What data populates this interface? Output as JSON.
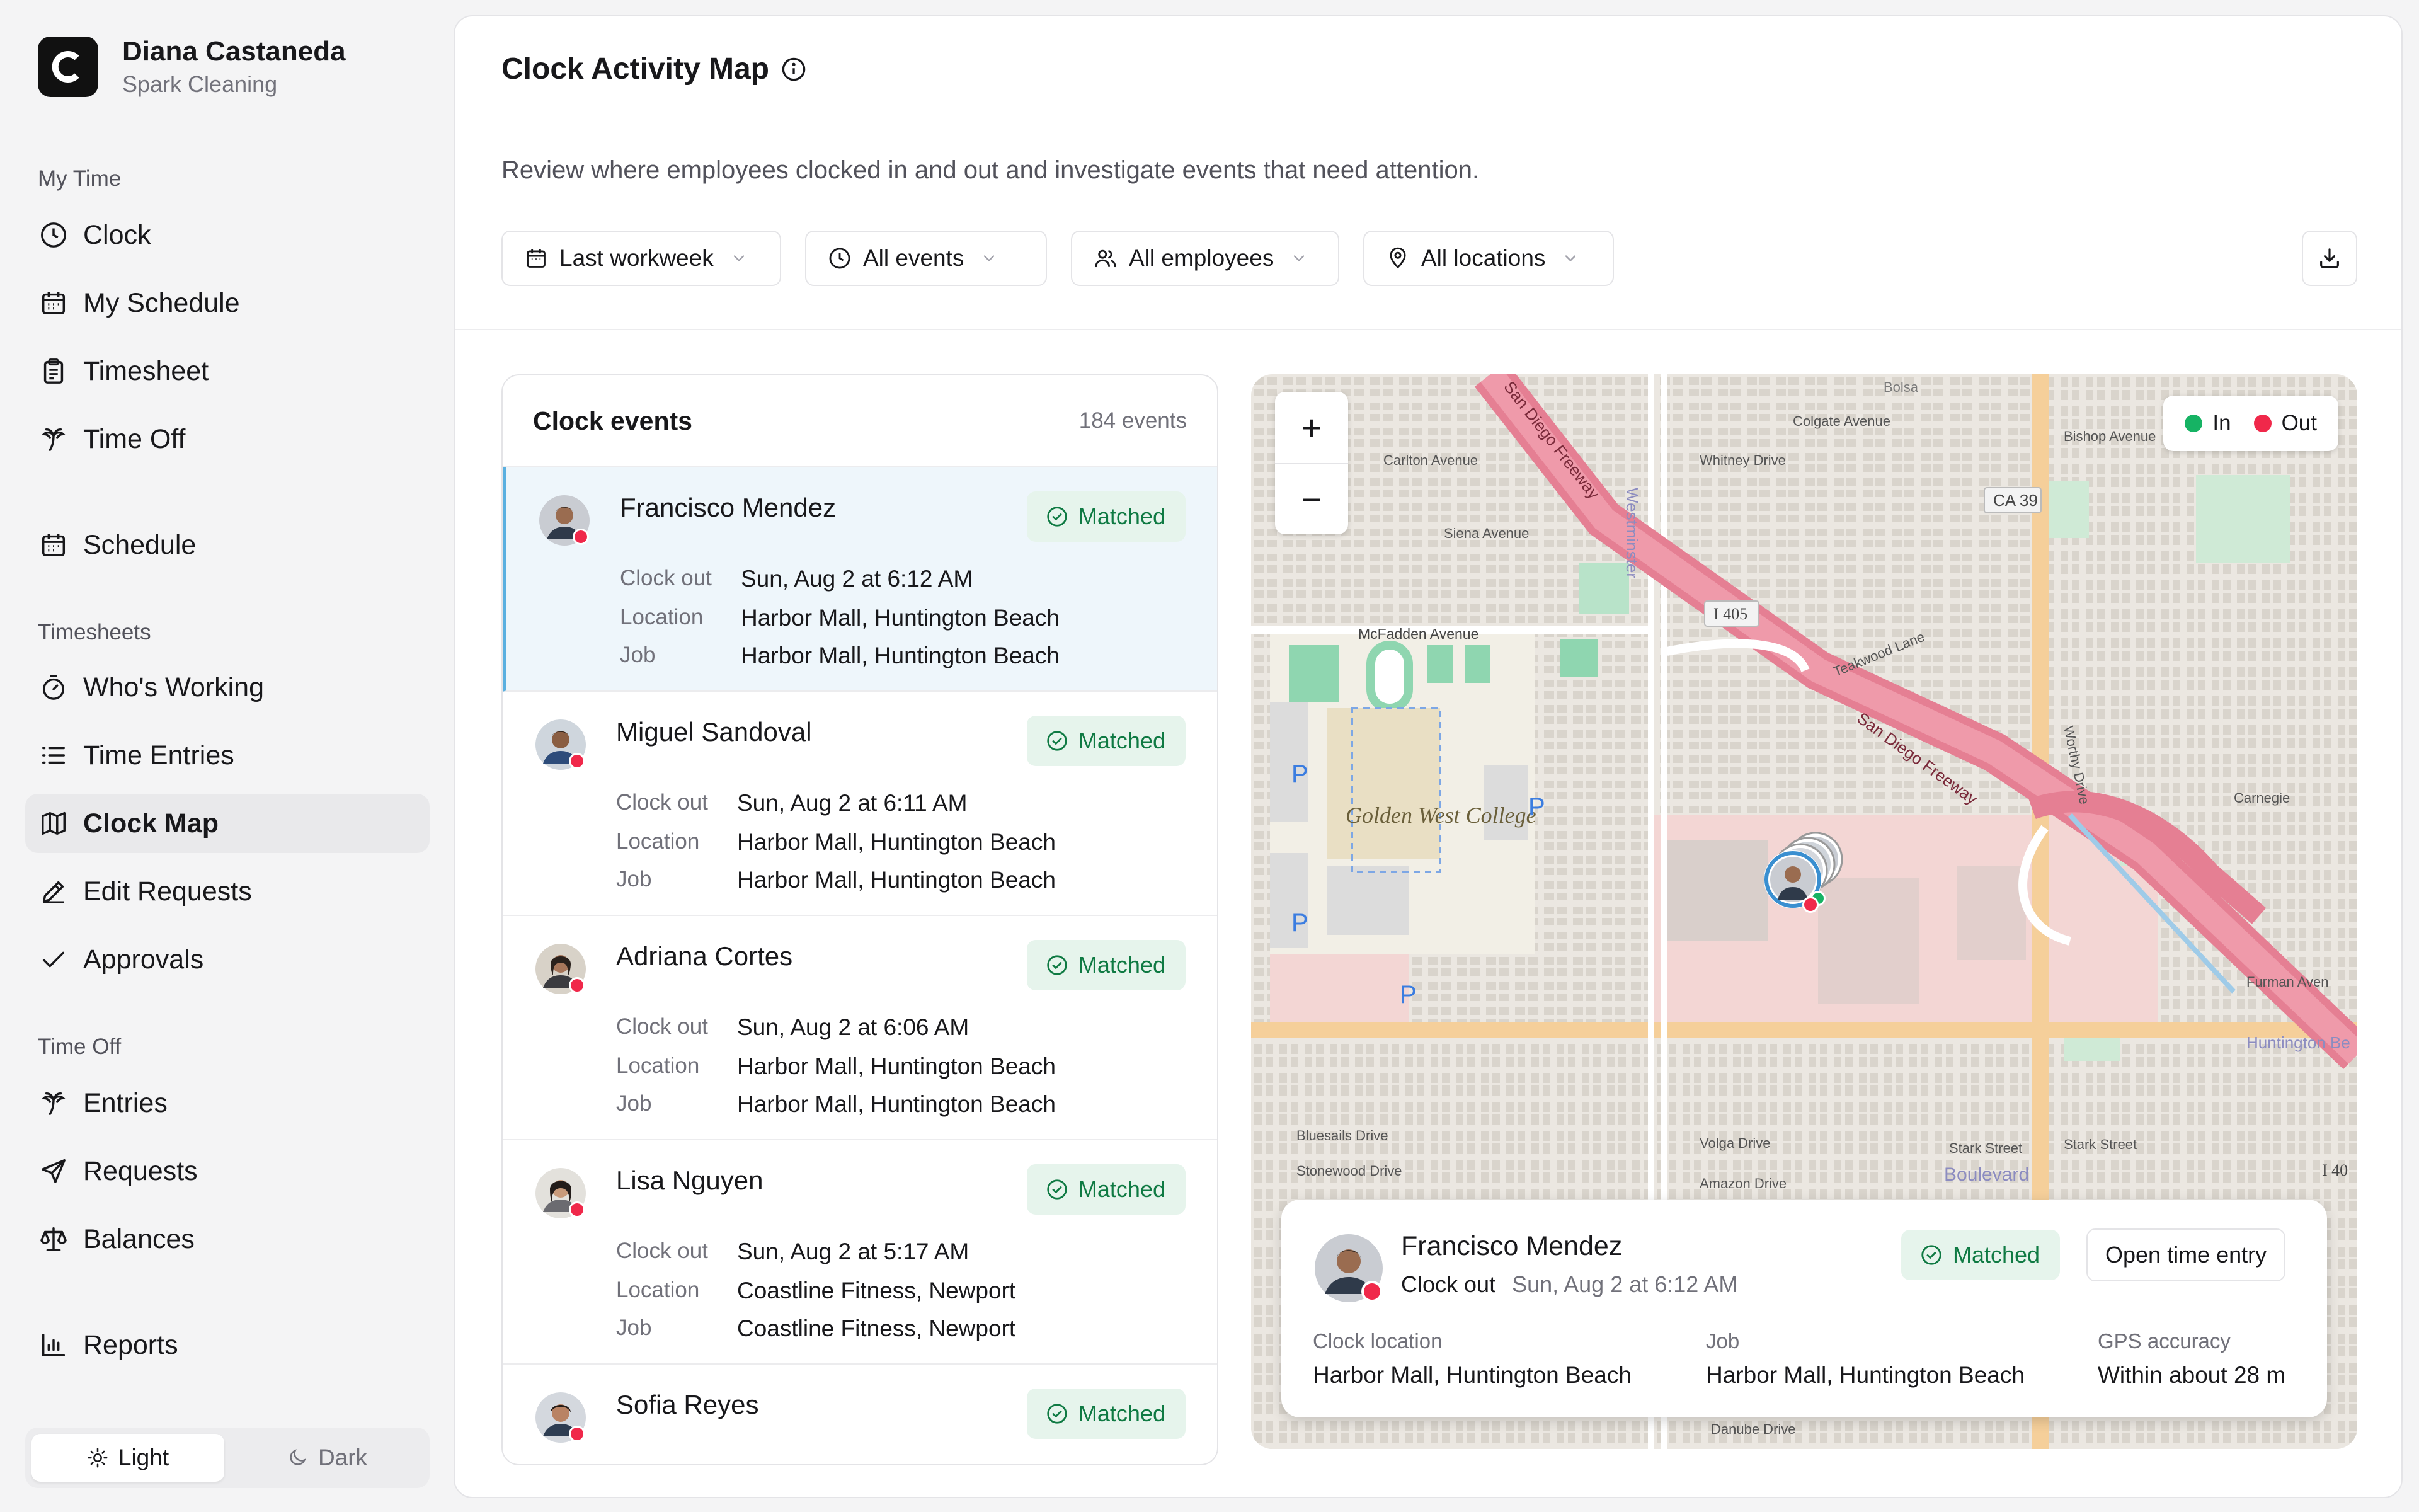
{
  "user": {
    "initial": "C",
    "name": "Diana Castaneda",
    "company": "Spark Cleaning"
  },
  "sidebar": {
    "sections": {
      "my_time": "My Time",
      "timesheets": "Timesheets",
      "time_off": "Time Off"
    },
    "items": {
      "clock": "Clock",
      "my_schedule": "My Schedule",
      "timesheet": "Timesheet",
      "time_off": "Time Off",
      "schedule": "Schedule",
      "whos_working": "Who's Working",
      "time_entries": "Time Entries",
      "clock_map": "Clock Map",
      "edit_requests": "Edit Requests",
      "approvals": "Approvals",
      "entries": "Entries",
      "requests": "Requests",
      "balances": "Balances",
      "reports": "Reports"
    },
    "active_item": "Clock Map",
    "theme": {
      "light": "Light",
      "dark": "Dark",
      "selected": "Light"
    }
  },
  "page": {
    "title": "Clock Activity Map",
    "subtitle": "Review where employees clocked in and out and investigate events that need attention."
  },
  "filters": {
    "date": "Last workweek",
    "events": "All events",
    "employees": "All employees",
    "locations": "All locations"
  },
  "events_panel": {
    "title": "Clock events",
    "count": "184 events",
    "labels": {
      "event": "Clock out",
      "location": "Location",
      "job": "Job"
    },
    "items": [
      {
        "name": "Francisco Mendez",
        "status": "Matched",
        "type": "Clock out",
        "time": "Sun, Aug 2 at 6:12 AM",
        "location": "Harbor Mall, Huntington Beach",
        "job": "Harbor Mall, Huntington Beach"
      },
      {
        "name": "Miguel Sandoval",
        "status": "Matched",
        "type": "Clock out",
        "time": "Sun, Aug 2 at 6:11 AM",
        "location": "Harbor Mall, Huntington Beach",
        "job": "Harbor Mall, Huntington Beach"
      },
      {
        "name": "Adriana Cortes",
        "status": "Matched",
        "type": "Clock out",
        "time": "Sun, Aug 2 at 6:06 AM",
        "location": "Harbor Mall, Huntington Beach",
        "job": "Harbor Mall, Huntington Beach"
      },
      {
        "name": "Lisa Nguyen",
        "status": "Matched",
        "type": "Clock out",
        "time": "Sun, Aug 2 at 5:17 AM",
        "location": "Coastline Fitness, Newport",
        "job": "Coastline Fitness, Newport"
      },
      {
        "name": "Sofia Reyes",
        "status": "Matched"
      }
    ]
  },
  "map": {
    "zoom_in": "+",
    "zoom_out": "−",
    "legend": {
      "in": "In",
      "out": "Out",
      "in_color": "#16b364",
      "out_color": "#f0284a"
    },
    "labels": {
      "freeway_1": "San Diego Freeway",
      "freeway_2": "San Diego Freeway",
      "mcfadden": "McFadden Avenue",
      "westminster": "Westminster",
      "i405": "I 405",
      "ca39": "CA 39",
      "college": "Golden West College",
      "colgate": "Colgate Avenue",
      "whitney": "Whitney Drive",
      "carlton": "Carlton Avenue",
      "siena": "Siena Avenue",
      "bolsa": "Bolsa",
      "bishop": "Bishop Avenue",
      "stark": "Stark Street",
      "boulevard": "Boulevard",
      "bluesails": "Bluesails Drive",
      "stonewood": "Stonewood Drive",
      "volga": "Volga Drive",
      "amazon": "Amazon Drive",
      "danube": "Danube Drive",
      "i40": "I 40",
      "teakwood": "Teakwood Lane",
      "worthy": "Worthy Drive",
      "carnegie": "Carnegie",
      "furman": "Furman Aven",
      "huntington_be": "Huntington Be",
      "parking": "P"
    },
    "card": {
      "name": "Francisco Mendez",
      "type": "Clock out",
      "time": "Sun, Aug 2 at 6:12 AM",
      "status": "Matched",
      "open_button": "Open time entry",
      "clock_location_label": "Clock location",
      "clock_location": "Harbor Mall, Huntington Beach",
      "job_label": "Job",
      "job": "Harbor Mall, Huntington Beach",
      "gps_label": "GPS accuracy",
      "gps": "Within about 28 m"
    }
  }
}
